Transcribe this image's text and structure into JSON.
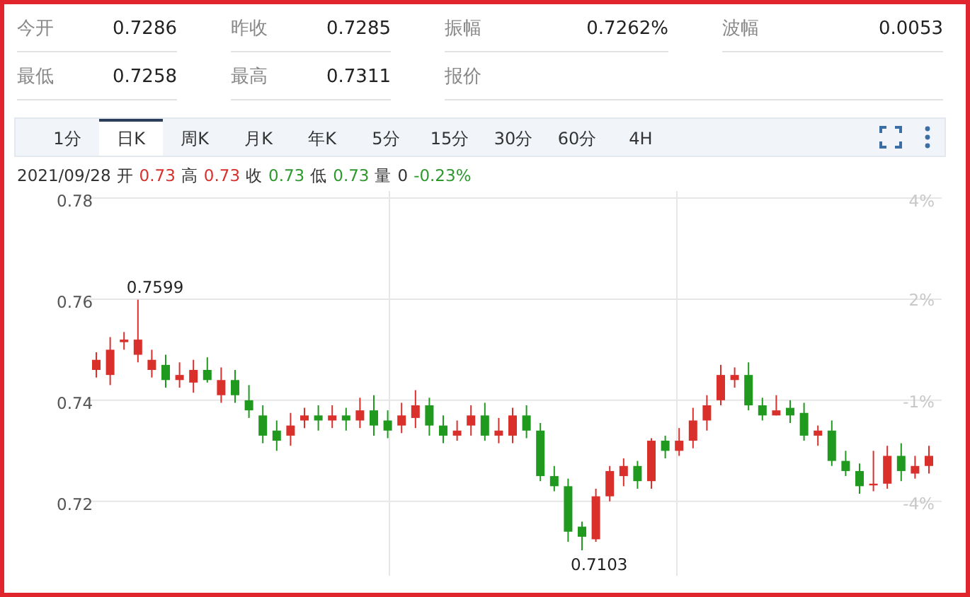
{
  "stats": [
    {
      "cells": [
        {
          "label": "今开",
          "value": "0.7286"
        },
        {
          "label": "昨收",
          "value": "0.7285"
        },
        {
          "label": "振幅",
          "value": "0.7262%"
        },
        {
          "label": "波幅",
          "value": "0.0053"
        }
      ]
    },
    {
      "cells": [
        {
          "label": "最低",
          "value": "0.7258"
        },
        {
          "label": "最高",
          "value": "0.7311"
        },
        {
          "label": "报价"
        }
      ]
    }
  ],
  "tabs": [
    {
      "label": "1分",
      "selected": false
    },
    {
      "label": "日K",
      "selected": true
    },
    {
      "label": "周K",
      "selected": false
    },
    {
      "label": "月K",
      "selected": false
    },
    {
      "label": "年K",
      "selected": false
    },
    {
      "label": "5分",
      "selected": false
    },
    {
      "label": "15分",
      "selected": false
    },
    {
      "label": "30分",
      "selected": false
    },
    {
      "label": "60分",
      "selected": false
    },
    {
      "label": "4H",
      "selected": false
    }
  ],
  "quote": {
    "date": "2021/09/28",
    "items": [
      {
        "label": "开",
        "value": "0.73",
        "color": "#d9302c"
      },
      {
        "label": "高",
        "value": "0.73",
        "color": "#d9302c"
      },
      {
        "label": "收",
        "value": "0.73",
        "color": "#2e9a2e"
      },
      {
        "label": "低",
        "value": "0.73",
        "color": "#2e9a2e"
      },
      {
        "label": "量",
        "value": "0",
        "color": "#333333"
      }
    ],
    "change": {
      "text": "-0.23%",
      "color": "#2e9a2e"
    }
  },
  "chart": {
    "pct_labels": [
      "4%",
      "2%",
      "-1%",
      "-4%"
    ],
    "chart_data": {
      "type": "candlestick",
      "grid": true,
      "ylim": [
        0.705,
        0.78
      ],
      "yticks": [
        0.78,
        0.76,
        0.74,
        0.72
      ],
      "ohlc": [
        [
          0.746,
          0.7495,
          0.7445,
          0.748
        ],
        [
          0.745,
          0.7525,
          0.743,
          0.75
        ],
        [
          0.7515,
          0.7535,
          0.75,
          0.752
        ],
        [
          0.749,
          0.7599,
          0.7475,
          0.752
        ],
        [
          0.746,
          0.75,
          0.7445,
          0.748
        ],
        [
          0.747,
          0.749,
          0.7425,
          0.744
        ],
        [
          0.744,
          0.7475,
          0.7425,
          0.745
        ],
        [
          0.7435,
          0.748,
          0.7415,
          0.746
        ],
        [
          0.746,
          0.7485,
          0.7435,
          0.744
        ],
        [
          0.741,
          0.7465,
          0.7395,
          0.744
        ],
        [
          0.744,
          0.746,
          0.7395,
          0.741
        ],
        [
          0.74,
          0.743,
          0.7365,
          0.738
        ],
        [
          0.737,
          0.739,
          0.7315,
          0.733
        ],
        [
          0.734,
          0.736,
          0.73,
          0.732
        ],
        [
          0.733,
          0.7375,
          0.731,
          0.735
        ],
        [
          0.736,
          0.7385,
          0.7345,
          0.737
        ],
        [
          0.737,
          0.739,
          0.734,
          0.736
        ],
        [
          0.736,
          0.739,
          0.7345,
          0.737
        ],
        [
          0.737,
          0.7385,
          0.734,
          0.736
        ],
        [
          0.736,
          0.7405,
          0.7345,
          0.738
        ],
        [
          0.738,
          0.741,
          0.733,
          0.735
        ],
        [
          0.736,
          0.738,
          0.7325,
          0.734
        ],
        [
          0.735,
          0.7395,
          0.7335,
          0.737
        ],
        [
          0.7365,
          0.742,
          0.7345,
          0.739
        ],
        [
          0.739,
          0.7405,
          0.733,
          0.735
        ],
        [
          0.735,
          0.737,
          0.7315,
          0.733
        ],
        [
          0.733,
          0.736,
          0.732,
          0.734
        ],
        [
          0.735,
          0.739,
          0.733,
          0.737
        ],
        [
          0.737,
          0.7395,
          0.732,
          0.733
        ],
        [
          0.733,
          0.7365,
          0.7315,
          0.734
        ],
        [
          0.733,
          0.7385,
          0.7315,
          0.737
        ],
        [
          0.737,
          0.739,
          0.7325,
          0.734
        ],
        [
          0.734,
          0.7355,
          0.724,
          0.725
        ],
        [
          0.725,
          0.727,
          0.722,
          0.723
        ],
        [
          0.723,
          0.7245,
          0.712,
          0.714
        ],
        [
          0.715,
          0.716,
          0.7103,
          0.713
        ],
        [
          0.7125,
          0.7225,
          0.712,
          0.721
        ],
        [
          0.721,
          0.727,
          0.72,
          0.726
        ],
        [
          0.725,
          0.7285,
          0.723,
          0.727
        ],
        [
          0.727,
          0.728,
          0.7225,
          0.724
        ],
        [
          0.724,
          0.7325,
          0.7225,
          0.732
        ],
        [
          0.732,
          0.733,
          0.7285,
          0.73
        ],
        [
          0.73,
          0.7345,
          0.729,
          0.732
        ],
        [
          0.732,
          0.7385,
          0.7305,
          0.736
        ],
        [
          0.736,
          0.741,
          0.734,
          0.739
        ],
        [
          0.74,
          0.747,
          0.739,
          0.745
        ],
        [
          0.744,
          0.7465,
          0.7425,
          0.745
        ],
        [
          0.745,
          0.7475,
          0.738,
          0.739
        ],
        [
          0.739,
          0.7405,
          0.736,
          0.737
        ],
        [
          0.737,
          0.741,
          0.737,
          0.738
        ],
        [
          0.7385,
          0.74,
          0.7355,
          0.737
        ],
        [
          0.7375,
          0.7395,
          0.732,
          0.733
        ],
        [
          0.733,
          0.735,
          0.731,
          0.734
        ],
        [
          0.734,
          0.736,
          0.727,
          0.728
        ],
        [
          0.728,
          0.73,
          0.725,
          0.726
        ],
        [
          0.726,
          0.7275,
          0.7215,
          0.723
        ],
        [
          0.7235,
          0.73,
          0.722,
          0.7235
        ],
        [
          0.7235,
          0.731,
          0.7225,
          0.729
        ],
        [
          0.729,
          0.7315,
          0.724,
          0.726
        ],
        [
          0.7255,
          0.729,
          0.7245,
          0.727
        ],
        [
          0.727,
          0.731,
          0.7255,
          0.729
        ]
      ],
      "annotations": [
        "0.7599",
        "0.7103"
      ]
    }
  }
}
